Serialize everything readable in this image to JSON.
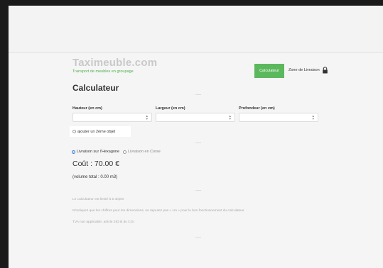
{
  "brand": {
    "name": "Taximeuble.com",
    "tagline": "Transport de meubles en groupage"
  },
  "nav": {
    "calculator_label": "Calculateur",
    "zone_label": "Zone de Livraison",
    "lock_icon": "lock-icon"
  },
  "page": {
    "title": "Calculateur"
  },
  "fields": [
    {
      "label": "Hauteur (en cm)",
      "value": ""
    },
    {
      "label": "Largeur (en cm)",
      "value": ""
    },
    {
      "label": "Profondeur (en cm)",
      "value": ""
    }
  ],
  "add_object": {
    "label": "ajouter un 2ème objet",
    "checked": false
  },
  "shipping": {
    "options": [
      {
        "label": "Livraison sur l'Hexagone",
        "selected": true
      },
      {
        "label": "Livraison en Corse",
        "selected": false
      }
    ]
  },
  "result": {
    "cost": "Coût : 70.00 €",
    "volume": "(volume total : 0.00 m3)"
  },
  "notes": [
    "Le calculateur est limité à 5 objets",
    "N'indiquez que les chiffres pour les dimensions, ne rajoutez pas « cm » pour le bon fonctionnement du calculateur",
    "TVA non applicable, article 293 B du CGI"
  ],
  "colors": {
    "accent": "#5cb85c",
    "tagline": "#4cae4c",
    "radio_selected": "#3a7bd5",
    "background": "#f5f5f5"
  }
}
